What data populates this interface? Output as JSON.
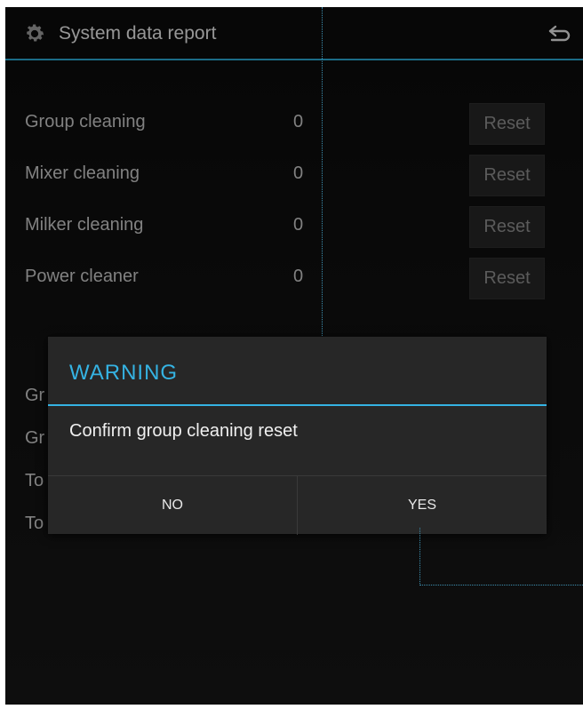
{
  "header": {
    "title": "System data report",
    "icon": "gear-icon",
    "back_icon": "back-icon"
  },
  "counters": [
    {
      "label": "Group cleaning",
      "value": "0",
      "action": "Reset"
    },
    {
      "label": "Mixer cleaning",
      "value": "0",
      "action": "Reset"
    },
    {
      "label": "Milker cleaning",
      "value": "0",
      "action": "Reset"
    },
    {
      "label": "Power cleaner",
      "value": "0",
      "action": "Reset"
    }
  ],
  "partial_rows": [
    "Gr",
    "Gr",
    "To",
    "To"
  ],
  "dialog": {
    "title": "WARNING",
    "message": "Confirm group cleaning reset",
    "no_label": "NO",
    "yes_label": "YES"
  },
  "colors": {
    "accent": "#35b3e3",
    "background": "#0b0b0b",
    "dialog_bg": "#272727"
  }
}
